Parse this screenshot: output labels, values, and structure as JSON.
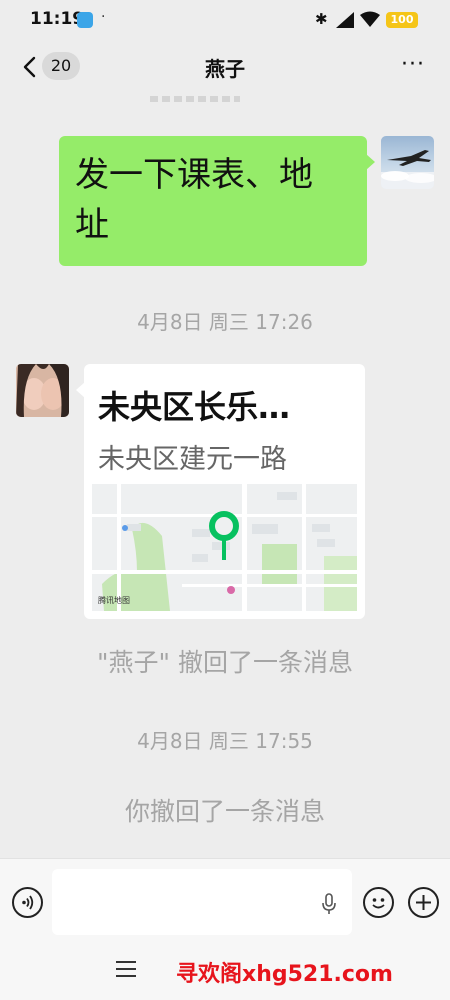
{
  "status_bar": {
    "time": "11:19",
    "dot": "·",
    "battery_level": "100",
    "bluetooth_glyph": "✱"
  },
  "nav": {
    "unread_count": "20",
    "title": "燕子",
    "more_glyph": "···"
  },
  "messages": {
    "sent_text_line1": "发一下课表、地",
    "sent_text_line2": "址",
    "timestamp_1": "4月8日 周三 17:26",
    "location_title": "未央区长乐…",
    "location_address": "未央区建元一路",
    "map_attribution": "腾讯地图",
    "recall_notice_other": "\"燕子\" 撤回了一条消息",
    "timestamp_2": "4月8日 周三 17:55",
    "recall_notice_self": "你撤回了一条消息"
  },
  "input_bar": {
    "text_value": "",
    "placeholder": ""
  },
  "watermark": "寻欢阁xhg521.com",
  "colors": {
    "background": "#ededed",
    "sent_bubble": "#95ec69",
    "received_bubble": "#ffffff",
    "system_text": "#a5a5a5",
    "map_pin": "#07c160",
    "watermark": "#e7141c"
  },
  "icons": {
    "back": "chevron-left-icon",
    "more": "more-dots-icon",
    "voice": "voice-icon",
    "mic": "microphone-icon",
    "emoji": "emoji-icon",
    "plus": "plus-icon",
    "menu": "menu-icon",
    "map_pin": "map-pin-icon"
  }
}
